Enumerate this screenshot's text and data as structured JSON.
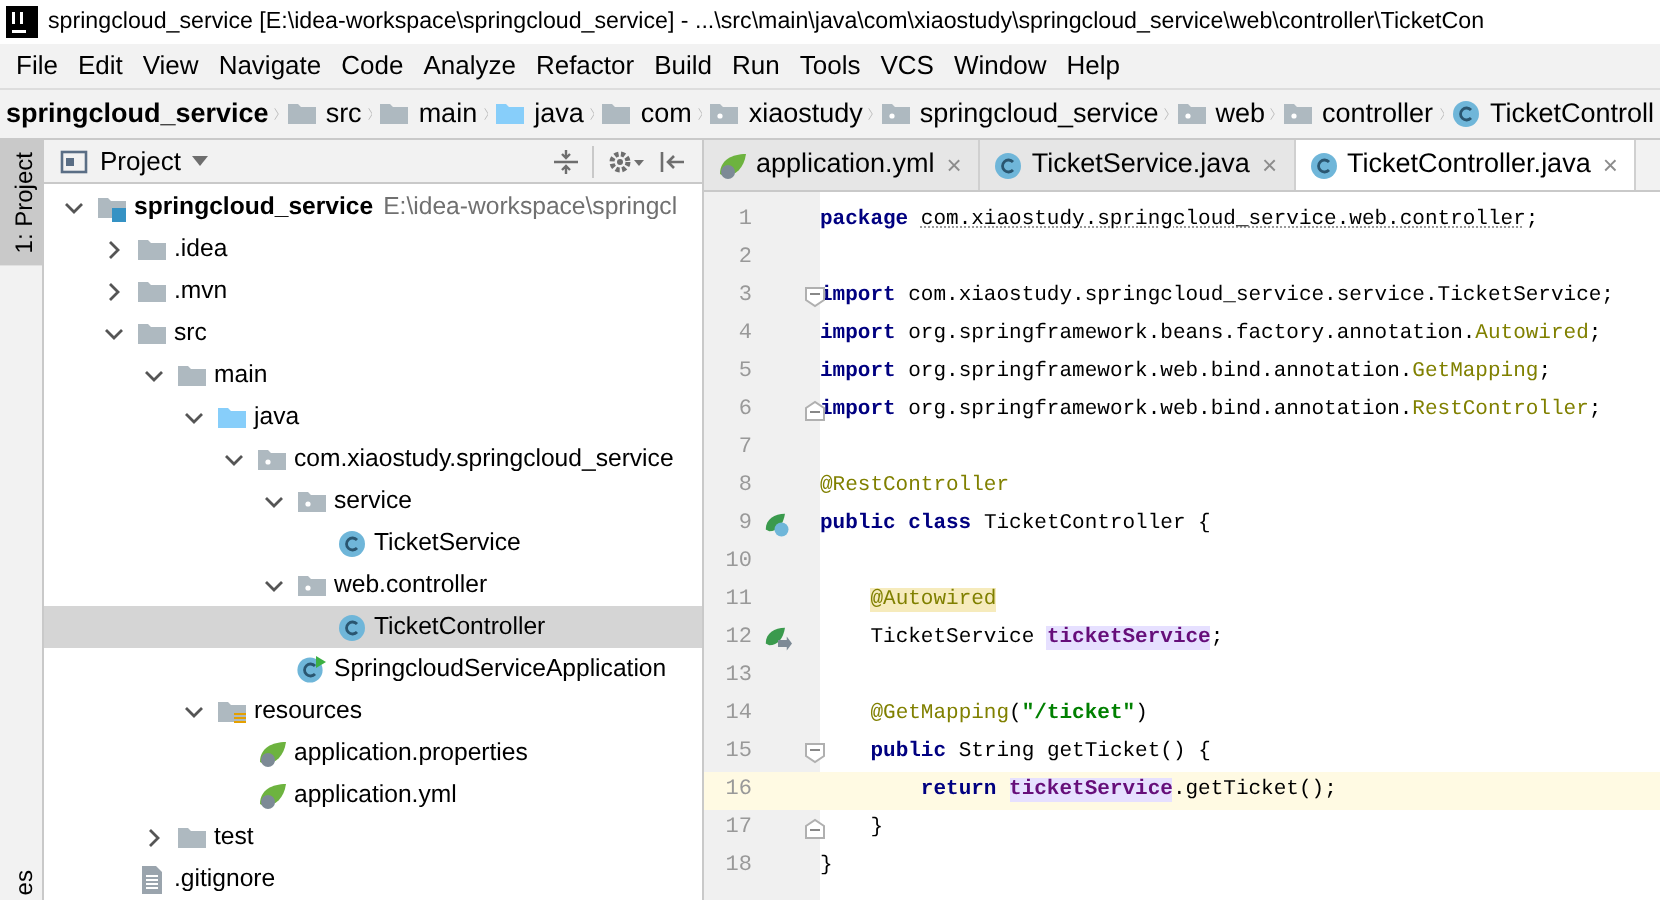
{
  "window": {
    "title": "springcloud_service [E:\\idea-workspace\\springcloud_service] - ...\\src\\main\\java\\com\\xiaostudy\\springcloud_service\\web\\controller\\TicketCon"
  },
  "menu": [
    "File",
    "Edit",
    "View",
    "Navigate",
    "Code",
    "Analyze",
    "Refactor",
    "Build",
    "Run",
    "Tools",
    "VCS",
    "Window",
    "Help"
  ],
  "breadcrumb": [
    {
      "label": "springcloud_service",
      "kind": "project"
    },
    {
      "label": "src",
      "kind": "folder"
    },
    {
      "label": "main",
      "kind": "folder"
    },
    {
      "label": "java",
      "kind": "source"
    },
    {
      "label": "com",
      "kind": "folder"
    },
    {
      "label": "xiaostudy",
      "kind": "package"
    },
    {
      "label": "springcloud_service",
      "kind": "package"
    },
    {
      "label": "web",
      "kind": "package"
    },
    {
      "label": "controller",
      "kind": "package"
    },
    {
      "label": "TicketControll",
      "kind": "class"
    }
  ],
  "side_strip": {
    "top": "1: Project",
    "bottom": "es"
  },
  "project_panel": {
    "title": "Project",
    "tree": [
      {
        "label": "springcloud_service",
        "path": "E:\\idea-workspace\\springcl",
        "kind": "module",
        "expanded": true,
        "selected": false,
        "children": [
          {
            "label": ".idea",
            "kind": "folder",
            "expanded": false,
            "selected": false
          },
          {
            "label": ".mvn",
            "kind": "folder",
            "expanded": false,
            "selected": false
          },
          {
            "label": "src",
            "kind": "folder",
            "expanded": true,
            "selected": false,
            "children": [
              {
                "label": "main",
                "kind": "folder",
                "expanded": true,
                "selected": false,
                "children": [
                  {
                    "label": "java",
                    "kind": "source",
                    "expanded": true,
                    "selected": false,
                    "children": [
                      {
                        "label": "com.xiaostudy.springcloud_service",
                        "kind": "package",
                        "expanded": true,
                        "selected": false,
                        "children": [
                          {
                            "label": "service",
                            "kind": "package",
                            "expanded": true,
                            "selected": false,
                            "children": [
                              {
                                "label": "TicketService",
                                "kind": "class",
                                "selected": false
                              }
                            ]
                          },
                          {
                            "label": "web.controller",
                            "kind": "package",
                            "expanded": true,
                            "selected": false,
                            "children": [
                              {
                                "label": "TicketController",
                                "kind": "class",
                                "selected": true
                              }
                            ]
                          },
                          {
                            "label": "SpringcloudServiceApplication",
                            "kind": "boot-class",
                            "selected": false
                          }
                        ]
                      }
                    ]
                  },
                  {
                    "label": "resources",
                    "kind": "resources",
                    "expanded": true,
                    "selected": false,
                    "children": [
                      {
                        "label": "application.properties",
                        "kind": "spring",
                        "selected": false
                      },
                      {
                        "label": "application.yml",
                        "kind": "spring",
                        "selected": false
                      }
                    ]
                  }
                ]
              },
              {
                "label": "test",
                "kind": "folder",
                "expanded": false,
                "selected": false
              }
            ]
          },
          {
            "label": ".gitignore",
            "kind": "file",
            "selected": false
          }
        ]
      }
    ]
  },
  "tabs": [
    {
      "label": "application.yml",
      "kind": "spring",
      "selected": false,
      "close": "×"
    },
    {
      "label": "TicketService.java",
      "kind": "class",
      "selected": false,
      "close": "×"
    },
    {
      "label": "TicketController.java",
      "kind": "class",
      "selected": true,
      "close": "×"
    }
  ],
  "editor": {
    "lines": [
      {
        "number": "1",
        "kind": "plain",
        "current": false,
        "tokens": [
          {
            "kind": "keyword",
            "text": "package"
          },
          {
            "kind": "package",
            "text": " com.xiaostudy.springcloud_service.web.controller"
          },
          {
            "kind": "plain",
            "text": ";"
          }
        ]
      },
      {
        "number": "2",
        "kind": "plain",
        "current": false
      },
      {
        "number": "3",
        "kind": "fold-start",
        "current": false,
        "tokens": [
          {
            "kind": "keyword",
            "text": "import"
          },
          {
            "kind": "plain",
            "text": " com.xiaostudy.springcloud_service.service.TicketService;"
          }
        ]
      },
      {
        "number": "4",
        "kind": "plain",
        "current": false,
        "tokens": [
          {
            "kind": "keyword",
            "text": "import"
          },
          {
            "kind": "plain",
            "text": " org.springframework.beans.factory.annotation."
          },
          {
            "kind": "annotation",
            "text": "Autowired"
          },
          {
            "kind": "plain",
            "text": ";"
          }
        ]
      },
      {
        "number": "5",
        "kind": "plain",
        "current": false,
        "tokens": [
          {
            "kind": "keyword",
            "text": "import"
          },
          {
            "kind": "plain",
            "text": " org.springframework.web.bind.annotation."
          },
          {
            "kind": "annotation",
            "text": "GetMapping"
          },
          {
            "kind": "plain",
            "text": ";"
          }
        ]
      },
      {
        "number": "6",
        "kind": "fold-end",
        "current": false,
        "tokens": [
          {
            "kind": "keyword",
            "text": "import"
          },
          {
            "kind": "plain",
            "text": " org.springframework.web.bind.annotation."
          },
          {
            "kind": "annotation",
            "text": "RestController"
          },
          {
            "kind": "plain",
            "text": ";"
          }
        ]
      },
      {
        "number": "7",
        "kind": "plain",
        "current": false
      },
      {
        "number": "8",
        "kind": "plain",
        "current": false,
        "tokens": [
          {
            "kind": "annotation",
            "text": "@RestController"
          }
        ]
      },
      {
        "number": "9",
        "kind": "bean-class",
        "current": false,
        "tokens": [
          {
            "kind": "keyword",
            "text": "public class"
          },
          {
            "kind": "plain",
            "text": " TicketController {"
          }
        ]
      },
      {
        "number": "10",
        "kind": "plain",
        "current": false
      },
      {
        "number": "11",
        "kind": "plain",
        "current": false,
        "tokens": [
          {
            "kind": "annotation-marked",
            "text": "    @Autowired"
          }
        ]
      },
      {
        "number": "12",
        "kind": "bean-field",
        "current": false,
        "tokens": [
          {
            "kind": "plain",
            "text": "    TicketService "
          },
          {
            "kind": "field-marked",
            "text": "ticketService"
          },
          {
            "kind": "plain",
            "text": ";"
          }
        ]
      },
      {
        "number": "13",
        "kind": "plain",
        "current": false
      },
      {
        "number": "14",
        "kind": "plain",
        "current": false,
        "tokens": [
          {
            "kind": "annotation",
            "text": "    @GetMapping"
          },
          {
            "kind": "plain",
            "text": "("
          },
          {
            "kind": "string",
            "text": "\"/ticket\""
          },
          {
            "kind": "plain",
            "text": ")"
          }
        ]
      },
      {
        "number": "15",
        "kind": "fold-start",
        "current": false,
        "tokens": [
          {
            "kind": "keyword",
            "text": "    public"
          },
          {
            "kind": "plain",
            "text": " String getTicket() {"
          }
        ]
      },
      {
        "number": "16",
        "kind": "plain",
        "current": true,
        "tokens": [
          {
            "kind": "keyword",
            "text": "        return "
          },
          {
            "kind": "field-marked",
            "text": "ticketService"
          },
          {
            "kind": "plain",
            "text": ".getTicket();"
          }
        ]
      },
      {
        "number": "17",
        "kind": "fold-end",
        "current": false,
        "tokens": [
          {
            "kind": "plain",
            "text": "    }"
          }
        ]
      },
      {
        "number": "18",
        "kind": "plain",
        "current": false,
        "tokens": [
          {
            "kind": "plain",
            "text": "}"
          }
        ]
      }
    ]
  }
}
